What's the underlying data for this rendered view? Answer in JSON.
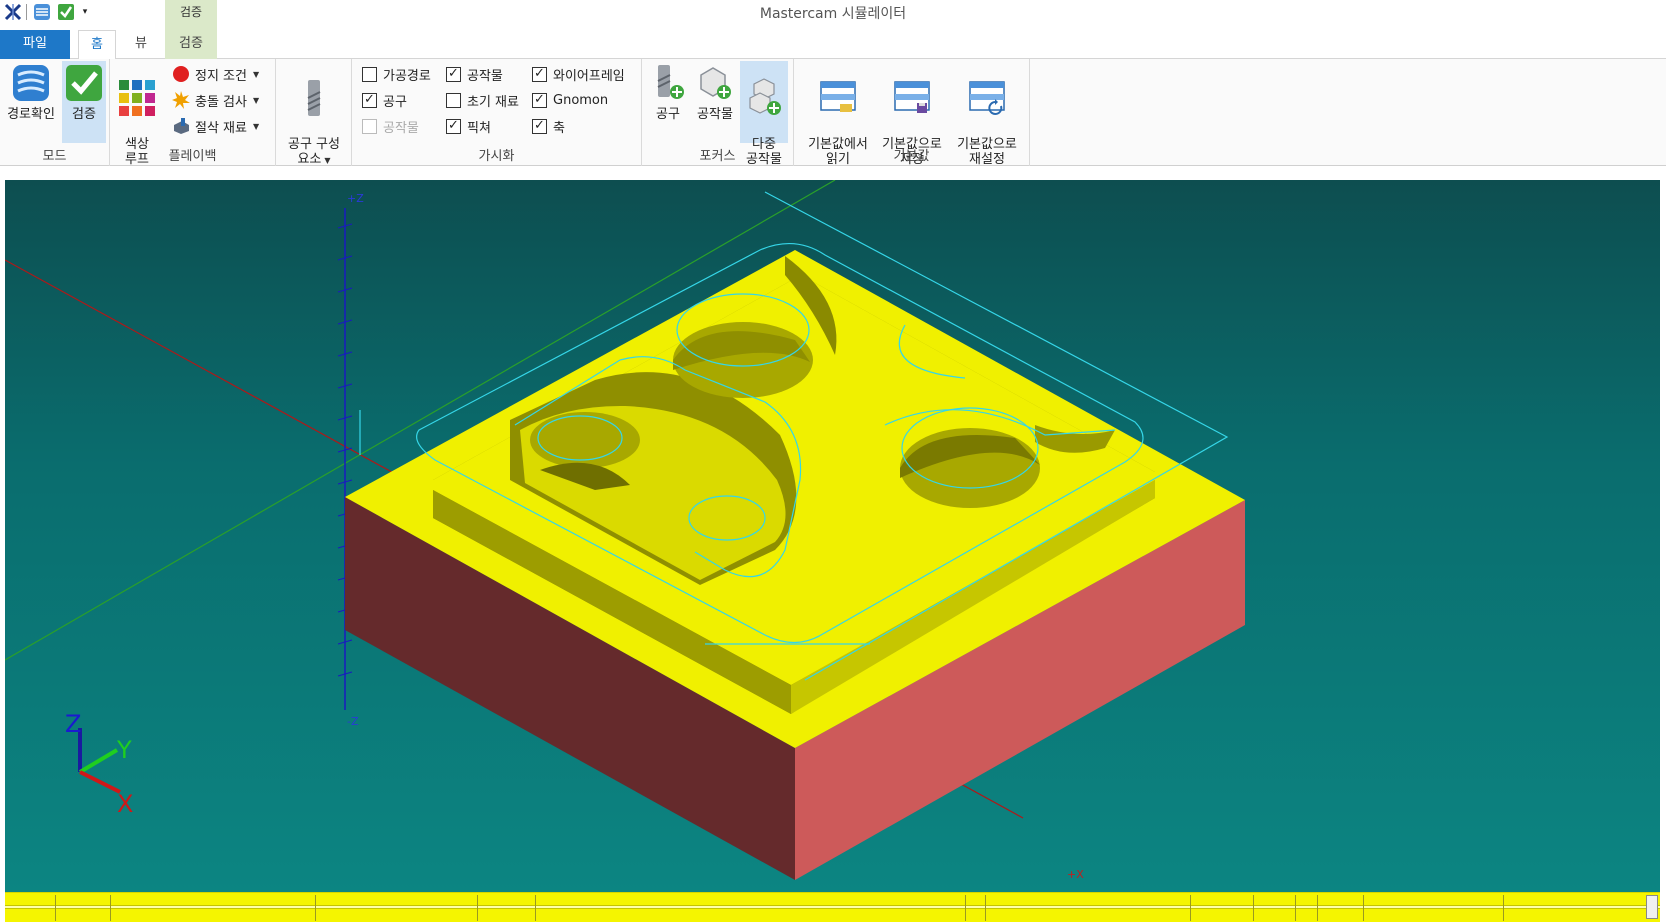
{
  "window": {
    "title": "Mastercam 시뮬레이터"
  },
  "context_tab_header": "검증",
  "tabs": {
    "file": "파일",
    "home": "홈",
    "view": "뷰",
    "verify": "검증"
  },
  "groups": {
    "mode": {
      "label": "모드",
      "backplot": "경로확인",
      "verify": "검증"
    },
    "playback": {
      "label": "플레이백",
      "color_loop": "색상\n루프",
      "stop_conditions": "정지 조건",
      "collision_check": "충돌 검사",
      "cut_stock": "절삭 재료"
    },
    "tool_components": {
      "label": "공구 구성\n요소"
    },
    "visibility": {
      "label": "가시화",
      "items": [
        {
          "label": "가공경로",
          "checked": false,
          "enabled": true
        },
        {
          "label": "공구",
          "checked": true,
          "enabled": true
        },
        {
          "label": "공작물",
          "checked": false,
          "enabled": false
        },
        {
          "label": "공작물",
          "checked": true,
          "enabled": true
        },
        {
          "label": "초기 재료",
          "checked": false,
          "enabled": true
        },
        {
          "label": "픽쳐",
          "checked": true,
          "enabled": true
        },
        {
          "label": "와이어프레임",
          "checked": true,
          "enabled": true
        },
        {
          "label": "Gnomon",
          "checked": true,
          "enabled": true
        },
        {
          "label": "축",
          "checked": true,
          "enabled": true
        }
      ]
    },
    "focus": {
      "label": "포커스",
      "tool": "공구",
      "workpiece": "공작물",
      "multi_workpiece": "다중\n공작물"
    },
    "defaults": {
      "label": "기본값",
      "load": "기본값에서\n읽기",
      "save": "기본값으로\n저장",
      "reset": "기본값으로\n재설정"
    }
  },
  "viewport": {
    "axis_labels": {
      "plus_z": "+Z",
      "minus_z": "-Z",
      "plus_x": "+X"
    },
    "gnomon": {
      "x": "X",
      "y": "Y",
      "z": "Z"
    }
  },
  "colors": {
    "accent": "#1e78c8",
    "stock_top": "#f0f000",
    "stock_left": "#652a2c",
    "stock_right": "#cd5a5a",
    "toolpath": "#35d6e8"
  }
}
